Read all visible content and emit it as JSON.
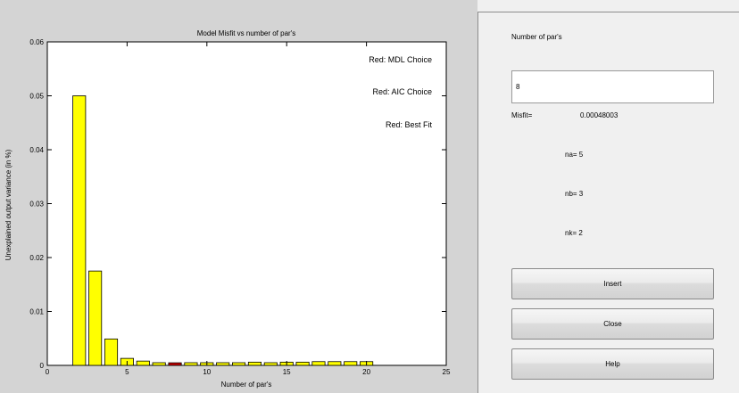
{
  "plot": {
    "title": "Model Misfit vs number of par's",
    "legend": [
      "Red: MDL Choice",
      "Red: AIC Choice",
      "Red: Best Fit"
    ]
  },
  "chart_data": {
    "type": "bar",
    "title": "Model Misfit vs number of par's",
    "xlabel": "Number of par's",
    "ylabel": "Unexplained output variance (in %)",
    "xlim": [
      0,
      25
    ],
    "ylim": [
      0,
      0.06
    ],
    "xticks": [
      0,
      5,
      10,
      15,
      20,
      25
    ],
    "yticks": [
      0,
      0.01,
      0.02,
      0.03,
      0.04,
      0.05,
      0.06
    ],
    "ytick_labels": [
      "0",
      "0.01",
      "0.02",
      "0.03",
      "0.04",
      "0.05",
      "0.06"
    ],
    "grid": false,
    "bar_color": "#ffff00",
    "highlight_color": "#cc0000",
    "highlight_x": 8,
    "x": [
      2,
      3,
      4,
      5,
      6,
      7,
      8,
      9,
      10,
      11,
      12,
      13,
      14,
      15,
      16,
      17,
      18,
      19,
      20
    ],
    "values": [
      0.05,
      0.0175,
      0.0049,
      0.0013,
      0.0008,
      0.0005,
      0.00048,
      0.0005,
      0.0005,
      0.0005,
      0.0005,
      0.0006,
      0.0005,
      0.0006,
      0.0006,
      0.0007,
      0.0007,
      0.0007,
      0.0007
    ]
  },
  "panel": {
    "number_label": "Number of par's",
    "number_value": "8",
    "misfit_label": "Misfit=",
    "misfit_value": "0.00048003",
    "na_text": "na=  5",
    "nb_text": "nb=  3",
    "nk_text": "nk=  2",
    "insert_label": "Insert",
    "close_label": "Close",
    "help_label": "Help"
  }
}
